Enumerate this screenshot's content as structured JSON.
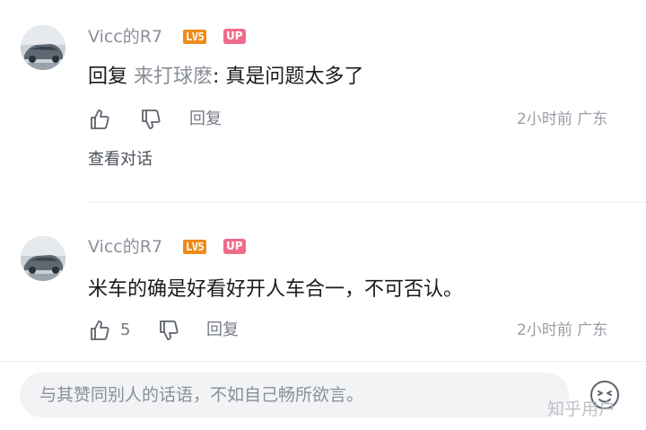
{
  "comments": [
    {
      "username": "Vicc的R7",
      "level_badge": "LV5",
      "up_badge": "UP",
      "reply_prefix": "回复",
      "reply_target": "来打球麽",
      "text": ": 真是问题太多了",
      "reply_label": "回复",
      "time": "2小时前",
      "location": "广东",
      "view_thread_label": "查看对话"
    },
    {
      "username": "Vicc的R7",
      "level_badge": "LV5",
      "up_badge": "UP",
      "text": "米车的确是好看好开人车合一，不可否认。",
      "like_count": "5",
      "reply_label": "回复",
      "time": "2小时前",
      "location": "广东"
    }
  ],
  "input": {
    "placeholder": "与其赞同别人的话语，不如自己畅所欲言。"
  },
  "watermark": "知乎用户",
  "icons": {
    "like": "thumbs-up-icon",
    "dislike": "thumbs-down-icon",
    "emoji": "emoji-icon"
  },
  "colors": {
    "level_badge": "#f08b1a",
    "up_badge": "#f06a8a",
    "muted_text": "#8a8f99"
  }
}
